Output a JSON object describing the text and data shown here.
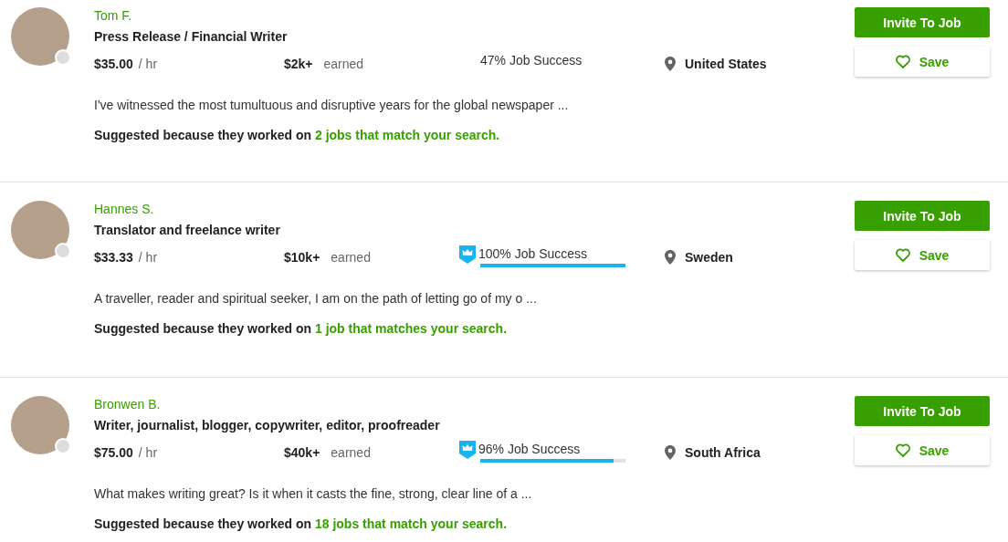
{
  "freelancers": [
    {
      "name": "Tom F.",
      "title": "Press Release / Financial Writer",
      "rate": "$35.00",
      "rate_unit": "/ hr",
      "earned": "$2k+",
      "earned_label": "earned",
      "job_success": "47% Job Success",
      "top_rated": false,
      "location": "United States",
      "overview": "I've witnessed the most tumultuous and disruptive years for the global newspaper ...",
      "suggestion": "Suggested because they worked on",
      "suggestion_link": "2 jobs that match your search.",
      "invite_button": "Invite To Job",
      "save_button": "Save"
    },
    {
      "name": "Hannes S.",
      "title": "Translator and freelance writer",
      "rate": "$33.33",
      "rate_unit": "/ hr",
      "earned": "$10k+",
      "earned_label": "earned",
      "job_success": "100% Job Success",
      "top_rated": true,
      "level": 1.0,
      "location": "Sweden",
      "overview": "A traveller, reader and spiritual seeker, I am on the path of letting go of my o ...",
      "suggestion": "Suggested because they worked on",
      "suggestion_link": "1 job that matches your search.",
      "invite_button": "Invite To Job",
      "save_button": "Save"
    },
    {
      "name": "Bronwen B.",
      "title": "Writer, journalist, blogger, copywriter, editor, proofreader",
      "rate": "$75.00",
      "rate_unit": "/ hr",
      "earned": "$40k+",
      "earned_label": "earned",
      "job_success": "96% Job Success",
      "top_rated": true,
      "level": 0.92,
      "location": "South Africa",
      "overview": "What makes writing great? Is it when it casts the fine, strong, clear line of a ...",
      "suggestion": "Suggested because they worked on",
      "suggestion_link": "18 jobs that match your search.",
      "invite_button": "Invite To Job",
      "save_button": "Save"
    }
  ]
}
